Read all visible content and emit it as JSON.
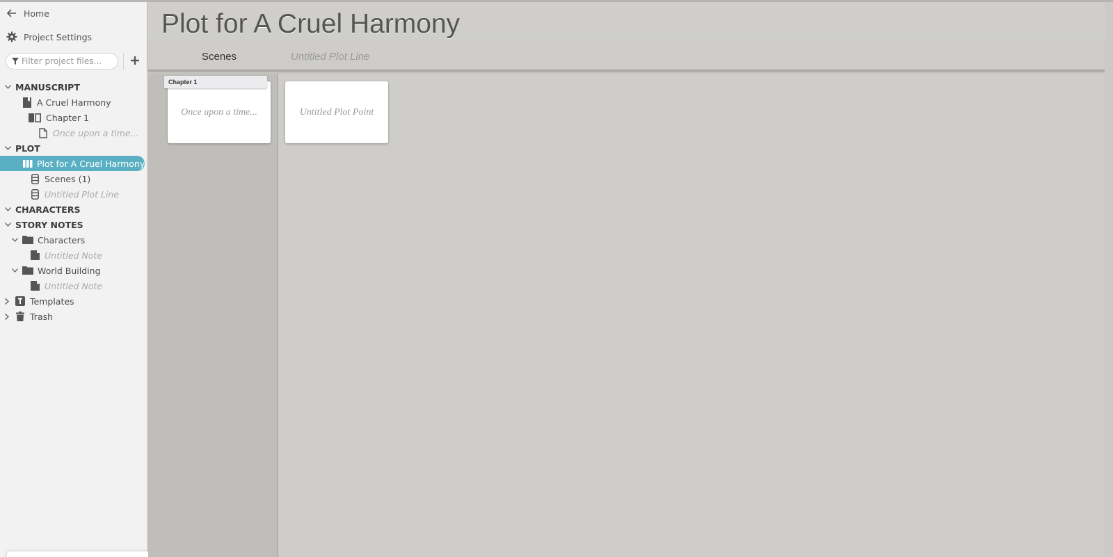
{
  "sidebar": {
    "home_label": "Home",
    "project_settings_label": "Project Settings",
    "filter_placeholder": "Filter project files...",
    "filter_value": "",
    "tree": {
      "manuscript": {
        "label": "MANUSCRIPT",
        "book": "A Cruel Harmony",
        "chapter": "Chapter 1",
        "scene": "Once upon a time..."
      },
      "plot": {
        "label": "PLOT",
        "plot_name": "Plot for A Cruel Harmony",
        "lines": [
          {
            "label": "Scenes  (1)"
          },
          {
            "label": "Untitled Plot Line"
          }
        ]
      },
      "characters": {
        "label": "CHARACTERS"
      },
      "story_notes": {
        "label": "STORY NOTES",
        "folders": [
          {
            "label": "Characters",
            "note": "Untitled Note"
          },
          {
            "label": "World Building",
            "note": "Untitled Note"
          }
        ]
      },
      "templates": {
        "label": "Templates"
      },
      "trash": {
        "label": "Trash"
      }
    }
  },
  "main": {
    "title": "Plot for A Cruel Harmony",
    "tabs": [
      {
        "label": "Scenes"
      },
      {
        "label": "Untitled Plot Line"
      }
    ],
    "cards": {
      "scene_chapter_tag": "Chapter 1",
      "scene_card": "Once upon a time...",
      "plot_point_card": "Untitled Plot Point"
    }
  },
  "colors": {
    "accent": "#5ab0c3",
    "header_bg": "#cfcdc9",
    "scenes_lane_bg": "#c0beba",
    "sidebar_bg": "#f2f2f2"
  }
}
